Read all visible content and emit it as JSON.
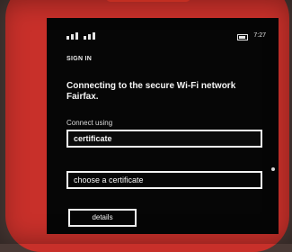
{
  "status_bar": {
    "time": "7:27",
    "signal_icon": "signal-bars-icon",
    "battery_icon": "battery-icon"
  },
  "dialog": {
    "title": "SIGN IN",
    "message": "Connecting to the secure Wi-Fi network Fairfax.",
    "connect_using_label": "Connect using",
    "connect_using_value": "certificate",
    "certificate_selector_text": "choose a certificate",
    "details_button": "details"
  },
  "colors": {
    "phone_frame": "#c8302a",
    "screen_background": "#060606",
    "text": "#f5f5f5"
  }
}
